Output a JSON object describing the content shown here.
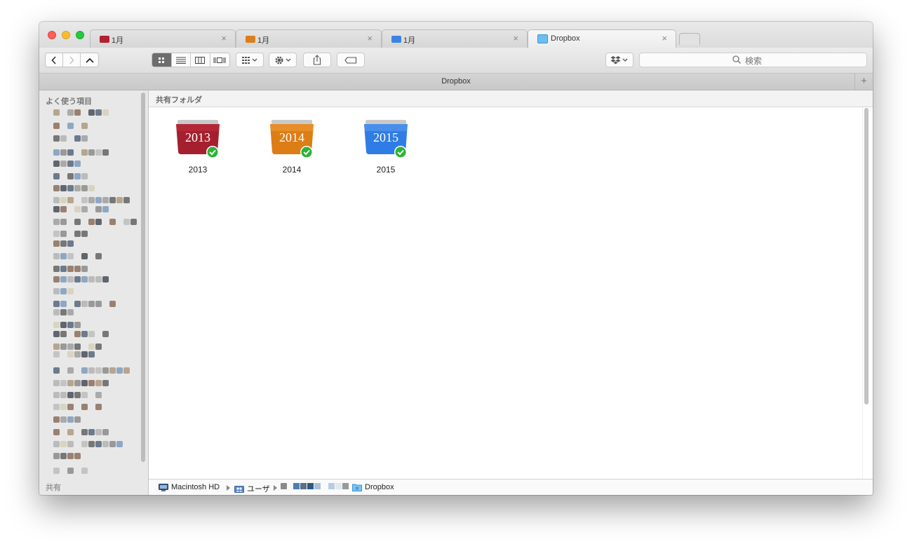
{
  "tabs": [
    {
      "label": "1月",
      "icon": "red-folder-icon",
      "color": "#b3202e"
    },
    {
      "label": "1月",
      "icon": "orange-folder-icon",
      "color": "#dc7e1a"
    },
    {
      "label": "1月",
      "icon": "blue-folder-icon",
      "color": "#3b82e6"
    },
    {
      "label": "Dropbox",
      "icon": "dropbox-folder-icon",
      "color": "#4aa7e8",
      "active": true
    }
  ],
  "tab_close": "×",
  "toolbar": {
    "back": "‹",
    "forward": "›",
    "up": "^",
    "search_placeholder": "検索"
  },
  "window_title": "Dropbox",
  "add_button": "+",
  "sidebar": {
    "favorites_header": "よく使う項目",
    "shared_header": "共有"
  },
  "content": {
    "section_header": "共有フォルダ",
    "folders": [
      {
        "name": "2013",
        "year_label": "2013",
        "color": "#a5202f",
        "synced": true
      },
      {
        "name": "2014",
        "year_label": "2014",
        "color": "#dc7d15",
        "synced": true
      },
      {
        "name": "2015",
        "year_label": "2015",
        "color": "#2f7ce6",
        "synced": true
      }
    ]
  },
  "breadcrumb": {
    "items": [
      {
        "label": "Macintosh HD",
        "icon": "hard-drive-icon"
      },
      {
        "label": "ユーザ",
        "icon": "users-folder-icon"
      },
      {
        "label": "Dropbox",
        "icon": "dropbox-folder-icon"
      }
    ]
  },
  "colors": {
    "accent_blue": "#4aa7e8",
    "sync_green": "#2db336"
  }
}
